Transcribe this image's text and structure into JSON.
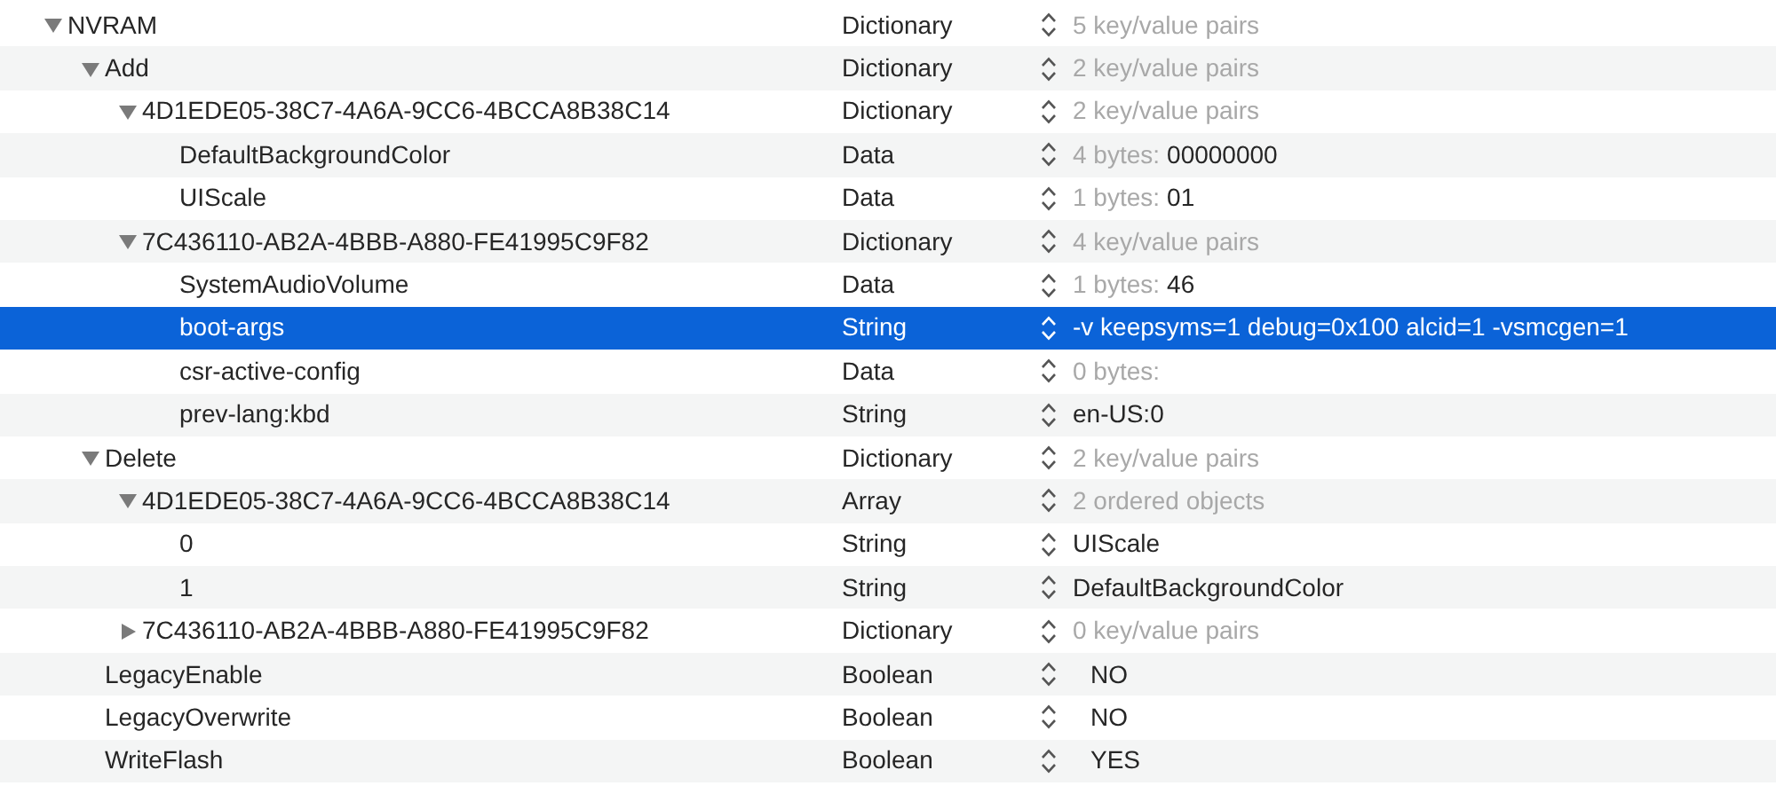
{
  "rows": [
    {
      "key": "NVRAM",
      "type": "Dictionary",
      "kind": "container",
      "summary": "5 key/value pairs",
      "expanded": true,
      "selected": false,
      "children": [
        {
          "key": "Add",
          "type": "Dictionary",
          "kind": "container",
          "summary": "2 key/value pairs",
          "expanded": true,
          "selected": false,
          "children": [
            {
              "key": "4D1EDE05-38C7-4A6A-9CC6-4BCCA8B38C14",
              "type": "Dictionary",
              "kind": "container",
              "summary": "2 key/value pairs",
              "expanded": true,
              "selected": false,
              "children": [
                {
                  "key": "DefaultBackgroundColor",
                  "type": "Data",
                  "kind": "data",
                  "summary": "4 bytes:",
                  "value": "00000000",
                  "selected": false
                },
                {
                  "key": "UIScale",
                  "type": "Data",
                  "kind": "data",
                  "summary": "1 bytes:",
                  "value": "01",
                  "selected": false
                }
              ]
            },
            {
              "key": "7C436110-AB2A-4BBB-A880-FE41995C9F82",
              "type": "Dictionary",
              "kind": "container",
              "summary": "4 key/value pairs",
              "expanded": true,
              "selected": false,
              "children": [
                {
                  "key": "SystemAudioVolume",
                  "type": "Data",
                  "kind": "data",
                  "summary": "1 bytes:",
                  "value": "46",
                  "selected": false
                },
                {
                  "key": "boot-args",
                  "type": "String",
                  "kind": "string",
                  "value": "-v keepsyms=1 debug=0x100 alcid=1 -vsmcgen=1",
                  "selected": true
                },
                {
                  "key": "csr-active-config",
                  "type": "Data",
                  "kind": "data",
                  "summary": "0 bytes:",
                  "selected": false
                },
                {
                  "key": "prev-lang:kbd",
                  "type": "String",
                  "kind": "string",
                  "value": "en-US:0",
                  "selected": false
                }
              ]
            }
          ]
        },
        {
          "key": "Delete",
          "type": "Dictionary",
          "kind": "container",
          "summary": "2 key/value pairs",
          "expanded": true,
          "selected": false,
          "children": [
            {
              "key": "4D1EDE05-38C7-4A6A-9CC6-4BCCA8B38C14",
              "type": "Array",
              "kind": "container",
              "summary": "2 ordered objects",
              "expanded": true,
              "selected": false,
              "children": [
                {
                  "key": "0",
                  "type": "String",
                  "kind": "string",
                  "value": "UIScale",
                  "selected": false
                },
                {
                  "key": "1",
                  "type": "String",
                  "kind": "string",
                  "value": "DefaultBackgroundColor",
                  "selected": false
                }
              ]
            },
            {
              "key": "7C436110-AB2A-4BBB-A880-FE41995C9F82",
              "type": "Dictionary",
              "kind": "container",
              "summary": "0 key/value pairs",
              "expanded": false,
              "selected": false
            }
          ]
        },
        {
          "key": "LegacyEnable",
          "type": "Boolean",
          "kind": "boolean",
          "value": "NO",
          "selected": false
        },
        {
          "key": "LegacyOverwrite",
          "type": "Boolean",
          "kind": "boolean",
          "value": "NO",
          "selected": false
        },
        {
          "key": "WriteFlash",
          "type": "Boolean",
          "kind": "boolean",
          "value": "YES",
          "selected": false
        }
      ]
    }
  ]
}
